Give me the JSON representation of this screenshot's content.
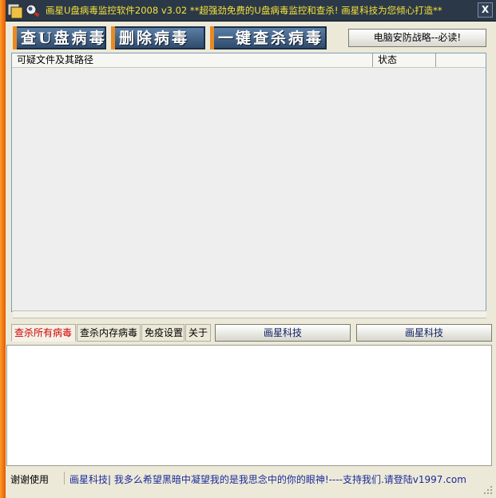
{
  "window": {
    "title": "画星U盘病毒监控软件2008 v3.02  **超强劲免费的U盘病毒监控和查杀! 画星科技为您倾心打造**",
    "close_label": "X"
  },
  "toolbar": {
    "scan_usb_label": "查U盘病毒",
    "delete_virus_label": "删除病毒",
    "one_click_kill_label": "一键查杀病毒",
    "security_tips_label": "电脑安防战略--必读!"
  },
  "results_table": {
    "columns": [
      "可疑文件及其路径",
      "状态"
    ],
    "rows": []
  },
  "tabs": [
    {
      "label": "查杀所有病毒",
      "active": true
    },
    {
      "label": "查杀内存病毒",
      "active": false
    },
    {
      "label": "免疫设置",
      "active": false
    },
    {
      "label": "关于",
      "active": false
    }
  ],
  "links": {
    "link1_label": "画星科技",
    "link2_label": "画星科技"
  },
  "log": {
    "text": ""
  },
  "statusbar": {
    "thanks": "谢谢使用",
    "message": "画星科技| 我多么希望黑暗中凝望我的是我思念中的你的眼神!----支持我们.请登陆v1997.com"
  },
  "colors": {
    "title_bg": "#2b3848",
    "title_text": "#f4e23a",
    "accent_orange": "#e88a21",
    "big_button_bg": "#3f6088",
    "active_tab_text": "#d00000",
    "status_text": "#1a2a9a"
  }
}
